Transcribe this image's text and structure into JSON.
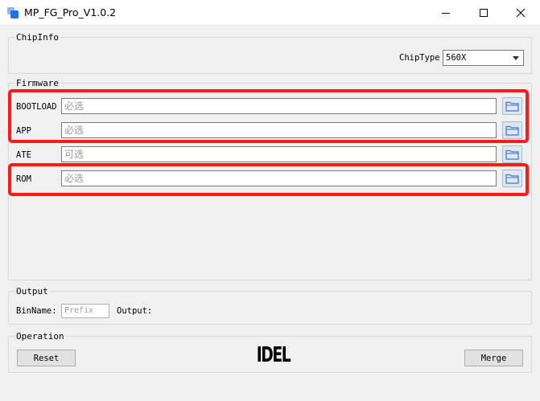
{
  "window": {
    "title": "MP_FG_Pro_V1.0.2"
  },
  "chipinfo": {
    "group_title": "ChipInfo",
    "chiptype_label": "ChipType",
    "chiptype_value": "560X"
  },
  "firmware": {
    "group_title": "Firmware",
    "rows": [
      {
        "label": "BOOTLOAD",
        "placeholder": "必选",
        "highlighted": true
      },
      {
        "label": "APP",
        "placeholder": "必选",
        "highlighted": true
      },
      {
        "label": "ATE",
        "placeholder": "可选",
        "highlighted": false
      },
      {
        "label": "ROM",
        "placeholder": "必选",
        "highlighted": true
      }
    ]
  },
  "output": {
    "group_title": "Output",
    "binname_label": "BinName:",
    "binname_placeholder": "Prefix",
    "output_label": "Output:"
  },
  "operation": {
    "group_title": "Operation",
    "reset_label": "Reset",
    "merge_label": "Merge",
    "status_text": "IDEL"
  },
  "colors": {
    "highlight": "#ff1a1a",
    "app_icon_front": "#1e6fff",
    "app_icon_back": "#8fb4ff"
  },
  "icons": [
    "app-icon",
    "minimize-icon",
    "maximize-icon",
    "close-icon",
    "folder-icon",
    "chevron-down-icon"
  ]
}
